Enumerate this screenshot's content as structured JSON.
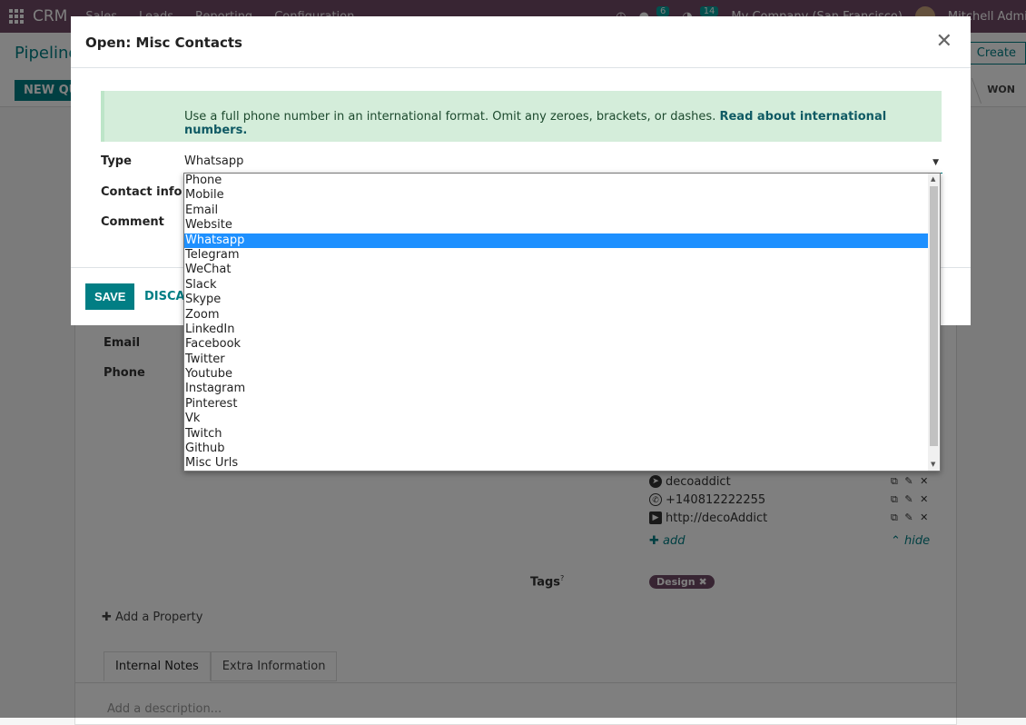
{
  "topbar": {
    "brand": "CRM",
    "menus": [
      "Sales",
      "Leads",
      "Reporting",
      "Configuration"
    ],
    "chat_count": "6",
    "activity_count": "14",
    "company": "My Company (San Francisco)",
    "user": "Mitchell Admin"
  },
  "control_panel": {
    "breadcrumb": "Pipeline",
    "create_label": "Create",
    "new_quotation_label": "NEW QU",
    "stage_won": "WON"
  },
  "background_form": {
    "email_label": "Email",
    "phone_label": "Phone",
    "misc_contacts": [
      {
        "icon": "telegram-icon",
        "value": "decoaddict"
      },
      {
        "icon": "whatsapp-icon",
        "value": "+140812222255"
      },
      {
        "icon": "video-icon",
        "value": "http://decoAddict"
      }
    ],
    "row_actions": "⧉ ✎ ✕",
    "add_label": "add",
    "hide_label": "hide",
    "tags_label": "Tags",
    "tags_help": "?",
    "tags": [
      "Design"
    ],
    "add_property": "Add a Property",
    "tabs": [
      "Internal Notes",
      "Extra Information"
    ],
    "description_placeholder": "Add a description..."
  },
  "dialog": {
    "title": "Open: Misc Contacts",
    "alert_text": "Use a full phone number in an international format. Omit any zeroes, brackets, or dashes.",
    "alert_link": "Read about international numbers.",
    "type_label": "Type",
    "contact_info_label": "Contact info",
    "comment_label": "Comment",
    "type_value": "Whatsapp",
    "save_label": "SAVE",
    "discard_label": "DISCARD"
  },
  "dropdown": {
    "options": [
      "Phone",
      "Mobile",
      "Email",
      "Website",
      "Whatsapp",
      "Telegram",
      "WeChat",
      "Slack",
      "Skype",
      "Zoom",
      "LinkedIn",
      "Facebook",
      "Twitter",
      "Youtube",
      "Instagram",
      "Pinterest",
      "Vk",
      "Twitch",
      "Github",
      "Misc Urls"
    ],
    "selected": "Whatsapp"
  },
  "colors": {
    "brand": "#714b67",
    "primary": "#017e84",
    "alert_bg": "#d4edda",
    "selected_option": "#1e90ff"
  }
}
